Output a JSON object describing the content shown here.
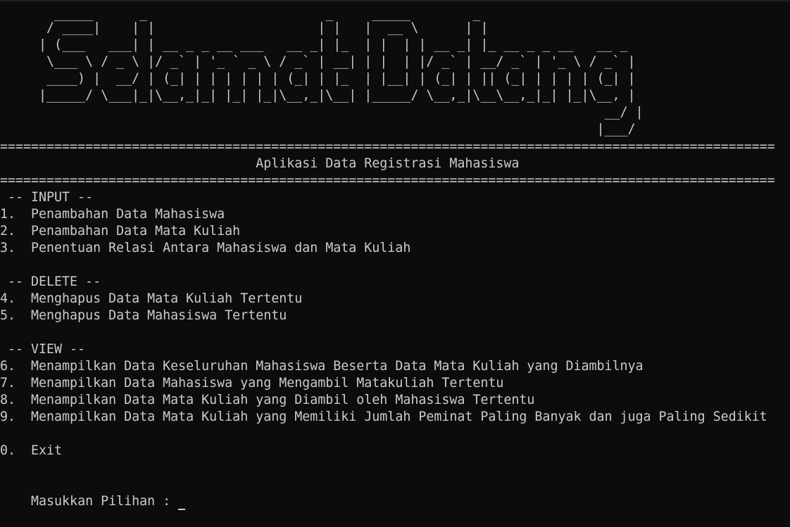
{
  "console": {
    "banner": [
      "       _____      _                       _     _____        _",
      "      / ____|    | |                     | |   |  __ \\      | |",
      "     | (___   ___| | __ _ _ __ ___   __ _| |_  | |  | | __ _| |_ __ _ _ __   __ _",
      "      \\___ \\ / _ \\ |/ _` | '_ ` _ \\ / _` | __| | |  | |/ _` | __/ _` | '_ \\ / _` |",
      "      ____) |  __/ | (_| | | | | | | (_| | |_  | |__| | (_| | || (_| | | | | (_| |",
      "     |_____/ \\___|_|\\__,_|_| |_| |_|\\__,_|\\__| |_____/ \\__,_|\\__\\__,_|_| |_|\\__, |",
      "                                                                              __/ |",
      "                                                                             |___/"
    ],
    "separator_top": "====================================================================================================",
    "app_title": "                                 Aplikasi Data Registrasi Mahasiswa",
    "separator_bottom": "====================================================================================================",
    "section_input": " -- INPUT --",
    "item_1": "1.  Penambahan Data Mahasiswa",
    "item_2": "2.  Penambahan Data Mata Kuliah",
    "item_3": "3.  Penentuan Relasi Antara Mahasiswa dan Mata Kuliah",
    "section_delete": " -- DELETE --",
    "item_4": "4.  Menghapus Data Mata Kuliah Tertentu",
    "item_5": "5.  Menghapus Data Mahasiswa Tertentu",
    "section_view": " -- VIEW --",
    "item_6": "6.  Menampilkan Data Keseluruhan Mahasiswa Beserta Data Mata Kuliah yang Diambilnya",
    "item_7": "7.  Menampilkan Data Mahasiswa yang Mengambil Matakuliah Tertentu",
    "item_8": "8.  Menampilkan Data Mata Kuliah yang Diambil oleh Mahasiswa Tertentu",
    "item_9": "9.  Menampilkan Data Mata Kuliah yang Memiliki Jumlah Peminat Paling Banyak dan juga Paling Sedikit",
    "item_0": "0.  Exit",
    "prompt": "Masukkan Pilihan : "
  }
}
